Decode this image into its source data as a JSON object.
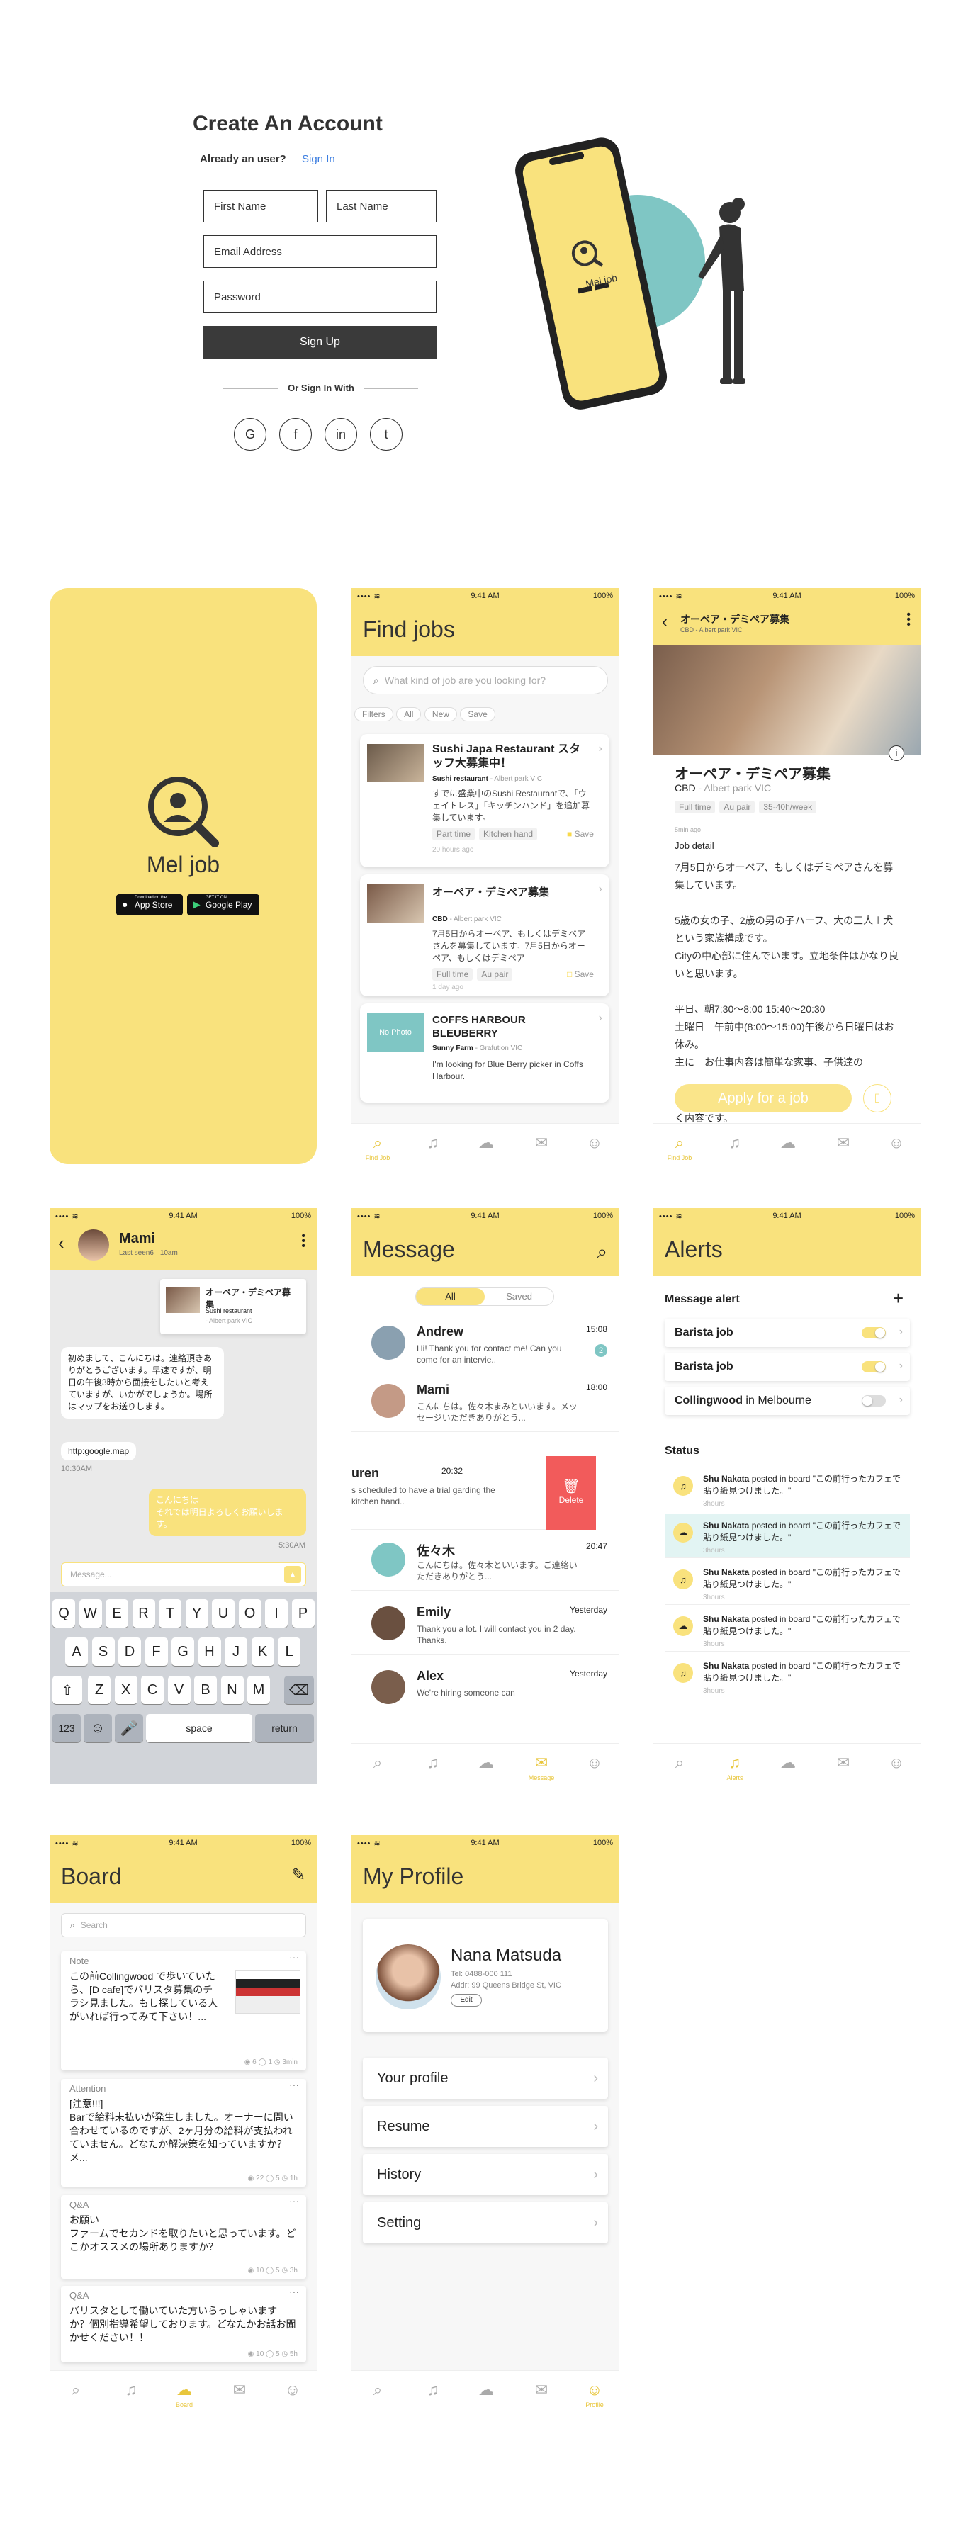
{
  "signup": {
    "title": "Create An Account",
    "already": "Already an user?",
    "signin": "Sign In",
    "first": "First Name",
    "last": "Last Name",
    "email": "Email Address",
    "password": "Password",
    "button": "Sign Up",
    "or": "Or Sign In With",
    "phone_brand": "Mel job"
  },
  "splash": {
    "brand": "Mel job",
    "appstore": "App Store",
    "appstore_small": "Download on the",
    "google": "Google Play",
    "google_small": "GET IT ON"
  },
  "statusbar": {
    "time": "9:41 AM",
    "battery": "100%"
  },
  "find": {
    "title": "Find jobs",
    "search": "What kind of job are you looking for?",
    "filters": [
      "Filters",
      "All",
      "New",
      "Save"
    ],
    "jobs": [
      {
        "title": "Sushi Japa Restaurant スタッフ大募集中！",
        "company": "Sushi restaurant",
        "loc": "- Albert park VIC",
        "desc": "すでに盛業中のSushi Restaurantで、「ウェイトレス」「キッチンハンド」を追加募集しています。",
        "tags": [
          "Part time",
          "Kitchen hand"
        ],
        "save": "Save",
        "ago": "20 hours ago"
      },
      {
        "title": "オーペア・デミペア募集",
        "company": "CBD",
        "loc": "- Albert park VIC",
        "desc": "7月5日からオーペア、もしくはデミペアさんを募集しています。7月5日からオーペア、もしくはデミペア",
        "tags": [
          "Full time",
          "Au pair"
        ],
        "save": "Save",
        "ago": "1 day ago"
      },
      {
        "title": "COFFS HARBOUR BLEUBERRY",
        "company": "Sunny Farm",
        "loc": "- Grafution VIC",
        "desc": "I'm looking for Blue Berry picker in Coffs Harbour.",
        "photo": "No Photo"
      }
    ],
    "tab_label": "Find Job"
  },
  "detail": {
    "header": "オーペア・デミペア募集",
    "sub": "CBD - Albert park VIC",
    "title": "オーペア・デミペア募集",
    "company": "CBD",
    "loc": "- Albert park VIC",
    "tags": [
      "Full time",
      "Au pair",
      "35-40h/week"
    ],
    "ago": "5min ago",
    "section": "Job detail",
    "body": "7月5日からオーペア、もしくはデミペアさんを募集しています。\n\n5歳の女の子、2歳の男の子ハーフ、大の三人＋犬という家族構成です。\nCityの中心部に住んでいます。立地条件はかなり良いと思います。\n\n平日、朝7:30〜8:00 15:40〜20:30\n土曜日　午前中(8:00〜15:00)午後から日曜日はお休み。\n主に　お仕事内容は簡単な家事、子供達の",
    "tail": "く内容です。",
    "apply": "Apply for a job"
  },
  "chat": {
    "name": "Mami",
    "seen": "Last seen6 · 10am",
    "card_title": "オーペア・デミペア募集",
    "card_company": "Sushi restaurant",
    "card_loc": "- Albert park VIC",
    "msg1": "初めまして、こんにちは。連絡頂きありがとうございます。早速ですが、明日の午後3時から面接をしたいと考えていますが、いかがでしょうか。場所はマップをお送りします。",
    "msg2": "http:google.map",
    "time1": "10:30AM",
    "reply": "こんにちは\nそれでは明日よろしくお願いします。",
    "time2": "5:30AM",
    "placeholder": "Message..."
  },
  "keyboard": {
    "row1": [
      "Q",
      "W",
      "E",
      "R",
      "T",
      "Y",
      "U",
      "O",
      "I",
      "P"
    ],
    "row2": [
      "A",
      "S",
      "D",
      "F",
      "G",
      "H",
      "J",
      "K",
      "L"
    ],
    "row3": [
      "Z",
      "X",
      "C",
      "V",
      "B",
      "N",
      "M"
    ],
    "num": "123",
    "space": "space",
    "ret": "return"
  },
  "messages": {
    "title": "Message",
    "tabs": [
      "All",
      "Saved"
    ],
    "items": [
      {
        "name": "Andrew",
        "time": "15:08",
        "text": "Hi! Thank you for contact me! Can you come for an intervie..",
        "badge": "2"
      },
      {
        "name": "Mami",
        "time": "18:00",
        "text": "こんにちは。佐々木まみといいます。メッセージいただきありがとう..."
      },
      {
        "name": "uren",
        "time": "20:32",
        "text": "s scheduled to have a trial garding the kitchen hand.."
      },
      {
        "name": "佐々木",
        "time": "20:47",
        "text": "こんにちは。佐々木といいます。ご連絡いただきありがとう..."
      },
      {
        "name": "Emily",
        "time": "Yesterday",
        "text": "Thank you a lot. I will contact you in 2 day. Thanks."
      },
      {
        "name": "Alex",
        "time": "Yesterday",
        "text": "We're hiring someone can"
      }
    ],
    "delete": "Delete",
    "tab_label": "Message"
  },
  "alerts": {
    "title": "Alerts",
    "section": "Message alert",
    "rules": [
      {
        "label": "Barista job",
        "extra": ""
      },
      {
        "label": "Barista job",
        "extra": ""
      },
      {
        "label": "Collingwood",
        "extra": " in Melbourne"
      }
    ],
    "status_title": "Status",
    "statuses": [
      {
        "name": "Shu Nakata",
        "text": " posted in board \"この前行ったカフェで貼り紙見つけました。\"",
        "ago": "3hours"
      },
      {
        "name": "Shu Nakata",
        "text": " posted in board \"この前行ったカフェで貼り紙見つけました。\"",
        "ago": "3hours"
      },
      {
        "name": "Shu Nakata",
        "text": " posted in board \"この前行ったカフェで貼り紙見つけました。\"",
        "ago": "3hours"
      },
      {
        "name": "Shu Nakata",
        "text": " posted in board \"この前行ったカフェで貼り紙見つけました。\"",
        "ago": "3hours"
      },
      {
        "name": "Shu Nakata",
        "text": " posted in board \"この前行ったカフェで貼り紙見つけました。\"",
        "ago": "3hours"
      }
    ],
    "tab_label": "Alerts"
  },
  "board": {
    "title": "Board",
    "search": "Search",
    "posts": [
      {
        "cat": "Note",
        "text": "この前Collingwood で歩いていたら、[D cafe]でバリスタ募集のチラシ見ました。もし探している人がいれば行ってみて下さい！...",
        "meta": "◉ 6  ◯ 1  ◷ 3min"
      },
      {
        "cat": "Attention",
        "text": "[注意!!!]\nBarで給料未払いが発生しました。オーナーに問い合わせているのですが、2ヶ月分の給料が支払われていません。どなたか解決策を知っていますか？メ...",
        "meta": "◉ 22  ◯ 5  ◷ 1h"
      },
      {
        "cat": "Q&A",
        "text": "お願い\nファームでセカンドを取りたいと思っています。どこかオススメの場所ありますか？",
        "meta": "◉ 10  ◯ 5  ◷ 3h"
      },
      {
        "cat": "Q&A",
        "text": "バリスタとして働いていた方いらっしゃいますか？個別指導希望しております。どなたかお話お聞かせください！！",
        "meta": "◉ 10  ◯ 5  ◷ 5h"
      }
    ],
    "tab_label": "Board"
  },
  "profile": {
    "title": "My Profile",
    "name": "Nana Matsuda",
    "tel": "Tel: 0488-000 111",
    "addr": "Addr: 99 Queens Bridge St, VIC",
    "edit": "Edit",
    "items": [
      "Your profile",
      "Resume",
      "History",
      "Setting"
    ],
    "tab_label": "Profile"
  },
  "colors": {
    "yellow": "#f9e27d",
    "dark": "#333333",
    "teal": "#7fc6c4",
    "red": "#f25b5b"
  }
}
